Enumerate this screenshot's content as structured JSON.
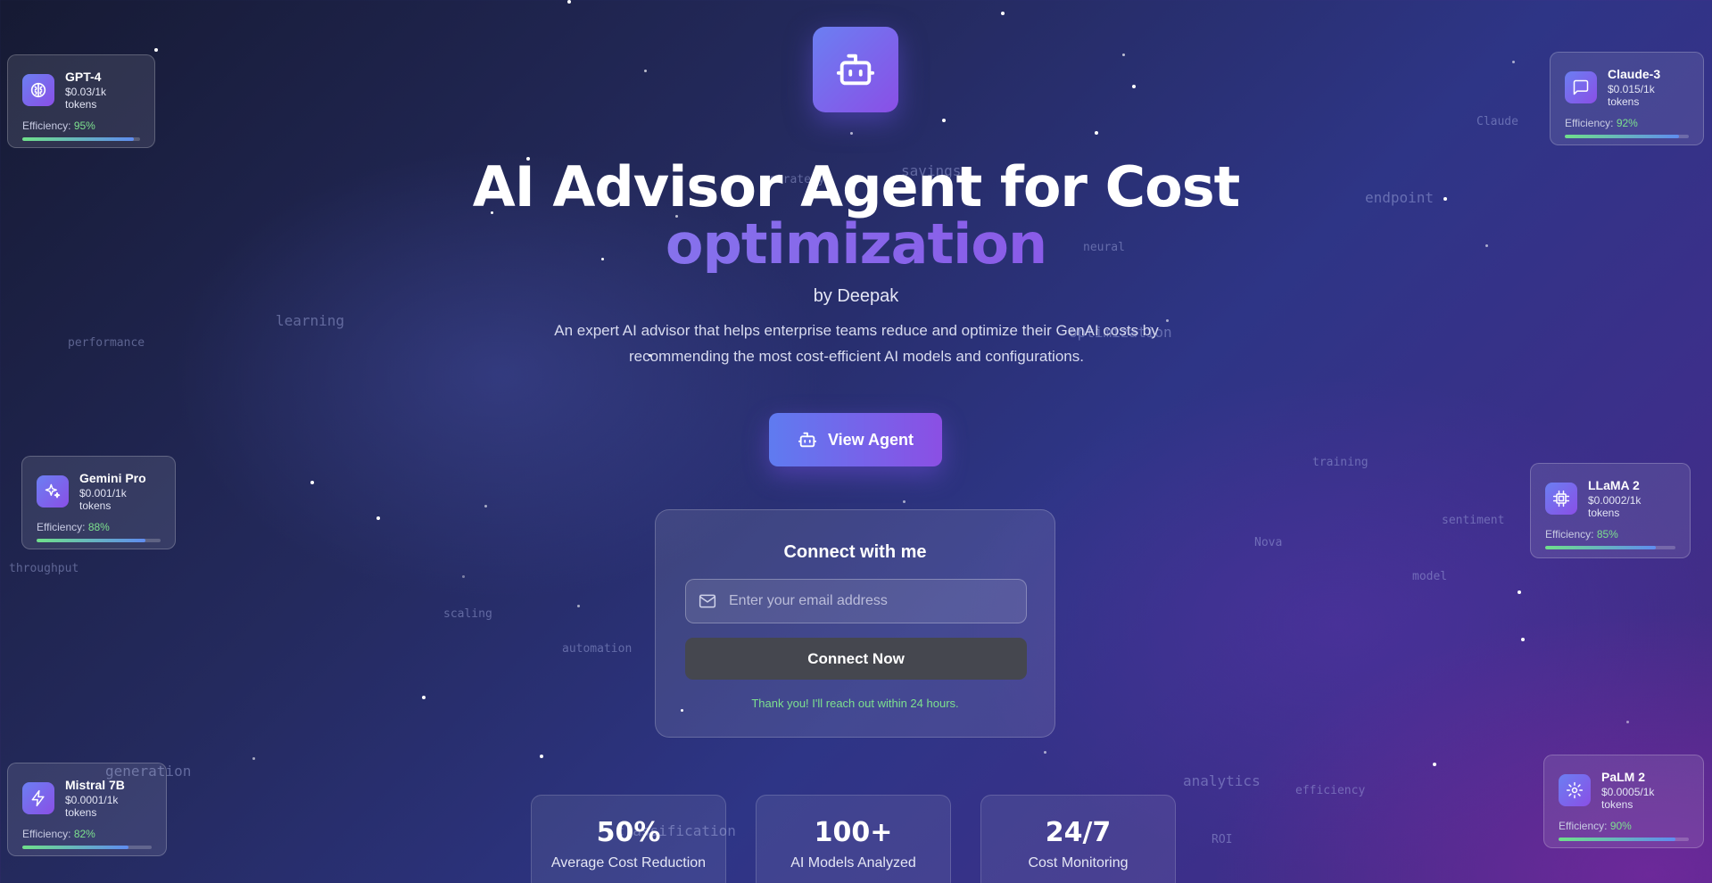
{
  "hero": {
    "title_line1": "AI Advisor Agent for Cost",
    "title_line2": "optimization",
    "byline": "by Deepak",
    "description": "An expert AI advisor that helps enterprise teams reduce and optimize their GenAI costs by recommending the most cost-efficient AI models and configurations.",
    "cta_label": "View Agent",
    "logo_icon": "robot-icon"
  },
  "connect": {
    "title": "Connect with me",
    "email_placeholder": "Enter your email address",
    "email_value": "",
    "button_label": "Connect Now",
    "confirmation": "Thank you! I'll reach out within 24 hours."
  },
  "models": [
    {
      "name": "GPT-4",
      "price": "$0.03/1k tokens",
      "efficiency_label": "Efficiency:",
      "efficiency": "95%",
      "efficiency_value": 0.95,
      "icon": "brain-icon"
    },
    {
      "name": "Claude-3",
      "price": "$0.015/1k tokens",
      "efficiency_label": "Efficiency:",
      "efficiency": "92%",
      "efficiency_value": 0.92,
      "icon": "chat-icon"
    },
    {
      "name": "Gemini Pro",
      "price": "$0.001/1k tokens",
      "efficiency_label": "Efficiency:",
      "efficiency": "88%",
      "efficiency_value": 0.88,
      "icon": "sparkles-icon"
    },
    {
      "name": "LLaMA 2",
      "price": "$0.0002/1k tokens",
      "efficiency_label": "Efficiency:",
      "efficiency": "85%",
      "efficiency_value": 0.85,
      "icon": "chip-icon"
    },
    {
      "name": "Mistral 7B",
      "price": "$0.0001/1k tokens",
      "efficiency_label": "Efficiency:",
      "efficiency": "82%",
      "efficiency_value": 0.82,
      "icon": "lightning-icon"
    },
    {
      "name": "PaLM 2",
      "price": "$0.0005/1k tokens",
      "efficiency_label": "Efficiency:",
      "efficiency": "90%",
      "efficiency_value": 0.9,
      "icon": "gear-icon"
    }
  ],
  "stats": [
    {
      "value": "50%",
      "label": "Average Cost Reduction"
    },
    {
      "value": "100+",
      "label": "AI Models Analyzed"
    },
    {
      "value": "24/7",
      "label": "Cost Monitoring"
    }
  ],
  "background_words": [
    "strategy",
    "savings",
    "neural",
    "endpoint",
    "Claude",
    "learning",
    "performance",
    "optimization",
    "training",
    "sentiment",
    "Nova",
    "model",
    "throughput",
    "scaling",
    "automation",
    "generation",
    "classification",
    "analytics",
    "efficiency",
    "ROI"
  ],
  "colors": {
    "accent_start": "#6b7ff2",
    "accent_end": "#8a4fe6",
    "success": "#7de08e",
    "connect_button": "#45474f"
  }
}
